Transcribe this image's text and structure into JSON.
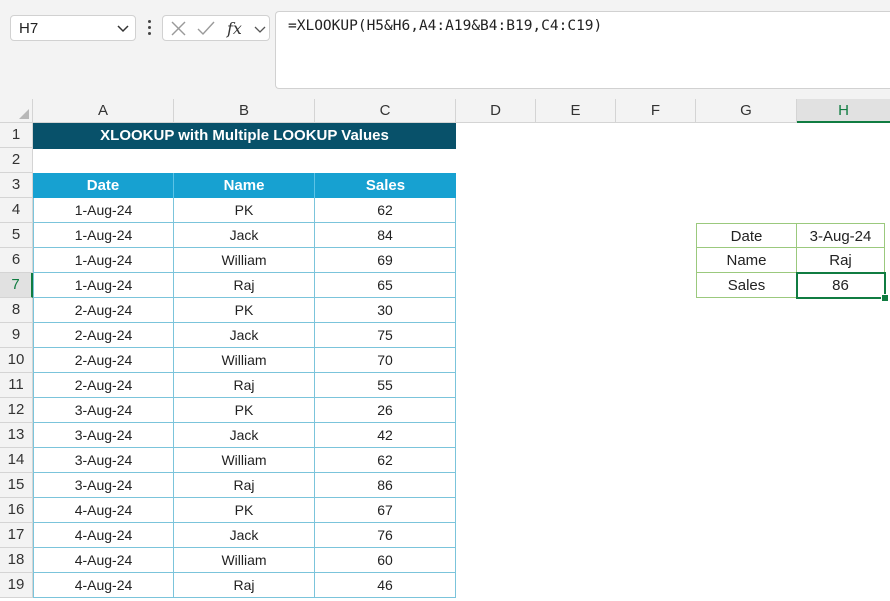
{
  "name_box": {
    "value": "H7"
  },
  "formula_bar": {
    "formula": "=XLOOKUP(H5&H6,A4:A19&B4:B19,C4:C19)"
  },
  "columns": [
    "A",
    "B",
    "C",
    "D",
    "E",
    "F",
    "G",
    "H"
  ],
  "rows": [
    "1",
    "2",
    "3",
    "4",
    "5",
    "6",
    "7",
    "8",
    "9",
    "10",
    "11",
    "12",
    "13",
    "14",
    "15",
    "16",
    "17",
    "18",
    "19"
  ],
  "sheet": {
    "title": "XLOOKUP with Multiple LOOKUP Values",
    "headers": [
      "Date",
      "Name",
      "Sales"
    ],
    "data": [
      [
        "1-Aug-24",
        "PK",
        "62"
      ],
      [
        "1-Aug-24",
        "Jack",
        "84"
      ],
      [
        "1-Aug-24",
        "William",
        "69"
      ],
      [
        "1-Aug-24",
        "Raj",
        "65"
      ],
      [
        "2-Aug-24",
        "PK",
        "30"
      ],
      [
        "2-Aug-24",
        "Jack",
        "75"
      ],
      [
        "2-Aug-24",
        "William",
        "70"
      ],
      [
        "2-Aug-24",
        "Raj",
        "55"
      ],
      [
        "3-Aug-24",
        "PK",
        "26"
      ],
      [
        "3-Aug-24",
        "Jack",
        "42"
      ],
      [
        "3-Aug-24",
        "William",
        "62"
      ],
      [
        "3-Aug-24",
        "Raj",
        "86"
      ],
      [
        "4-Aug-24",
        "PK",
        "67"
      ],
      [
        "4-Aug-24",
        "Jack",
        "76"
      ],
      [
        "4-Aug-24",
        "William",
        "60"
      ],
      [
        "4-Aug-24",
        "Raj",
        "46"
      ]
    ]
  },
  "lookup": {
    "labels": [
      "Date",
      "Name",
      "Sales"
    ],
    "values": [
      "3-Aug-24",
      "Raj",
      "86"
    ]
  },
  "colors": {
    "title_bg": "#08516a",
    "header_bg": "#17a1d1",
    "accent": "#107c41"
  }
}
